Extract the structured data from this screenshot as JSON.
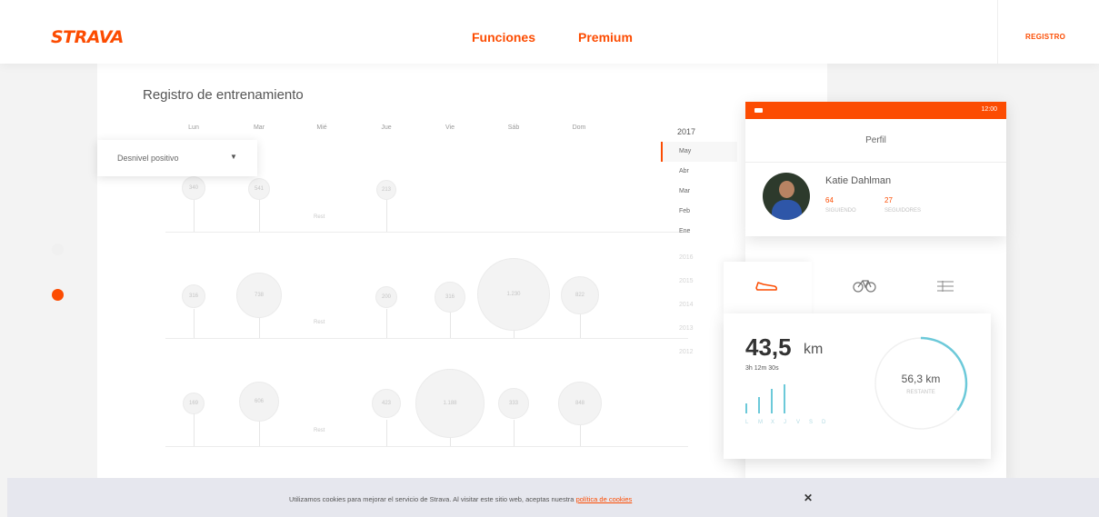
{
  "nav": {
    "logo": "STRAVA",
    "links": [
      "Funciones",
      "Premium"
    ],
    "register": "REGISTRO"
  },
  "training_log": {
    "title": "Registro de entrenamiento",
    "days": [
      "Lun",
      "Mar",
      "Mié",
      "Jue",
      "Vie",
      "Sáb",
      "Dom"
    ],
    "dropdown": "Desnivel positivo",
    "weeks": [
      {
        "bubbles": [
          "340",
          "541",
          "",
          "213",
          "",
          "",
          ""
        ],
        "rest": "Rest"
      },
      {
        "bubbles": [
          "316",
          "738",
          "",
          "200",
          "316",
          "1.230",
          "822"
        ],
        "rest": "Rest"
      },
      {
        "bubbles": [
          "169",
          "606",
          "",
          "423",
          "1.188",
          "333",
          "848"
        ],
        "rest": "Rest"
      }
    ],
    "year": "2017",
    "months": [
      "May",
      "Abr",
      "Mar",
      "Feb",
      "Ene"
    ],
    "older_years": [
      "2016",
      "2015",
      "2014",
      "2013",
      "2012"
    ]
  },
  "profile": {
    "time": "12:00",
    "title": "Perfil",
    "name": "Katie Dahlman",
    "stats": [
      {
        "value": "64",
        "label": "SIGUIENDO"
      },
      {
        "value": "27",
        "label": "SEGUIDORES"
      }
    ]
  },
  "activity": {
    "tabs": [
      "shoe-icon",
      "bike-icon",
      "list-icon"
    ],
    "distance": "43,5",
    "unit": "km",
    "duration": "3h 12m 30s",
    "week_letters": [
      "L",
      "M",
      "X",
      "J",
      "V",
      "S",
      "D"
    ],
    "goal_value": "56,3 km",
    "goal_label": "RESTANTE",
    "goal_progress": 0.35,
    "bars": [
      0.35,
      0.55,
      0.85,
      1.0
    ]
  },
  "cookie": {
    "text": "Utilizamos cookies para mejorar el servicio de Strava. Al visitar este sitio web, aceptas nuestra",
    "link": "política de cookies",
    "close": "✕"
  },
  "colors": {
    "accent": "#fc4c02",
    "teal": "#6cc9d9"
  }
}
